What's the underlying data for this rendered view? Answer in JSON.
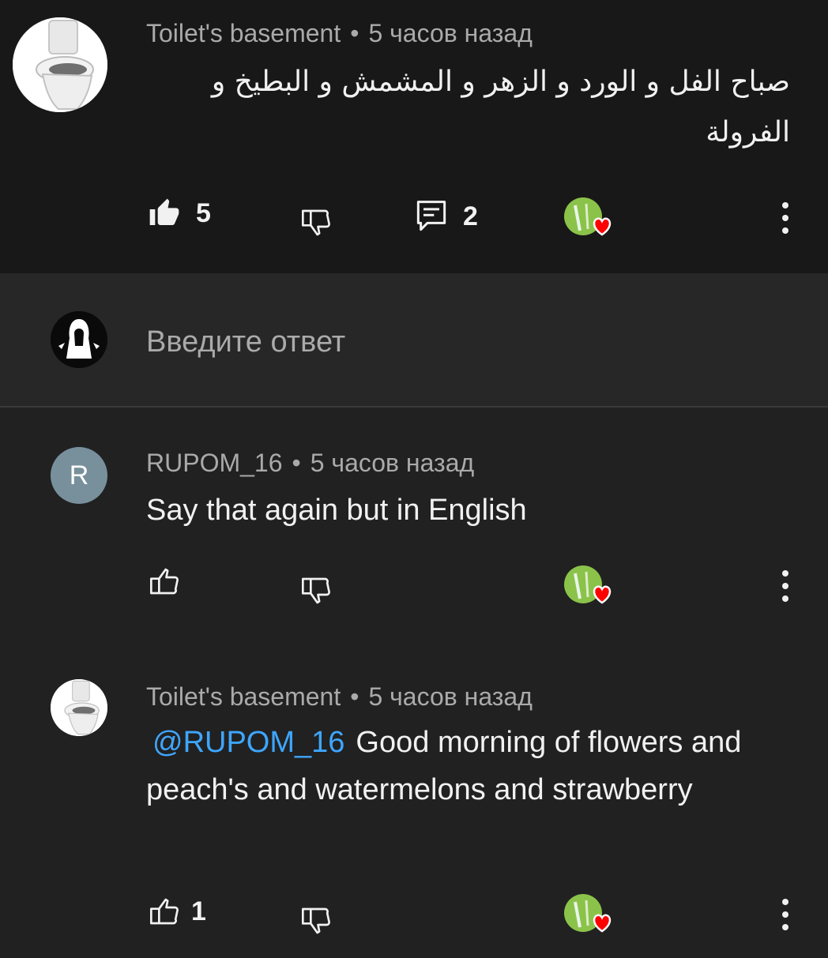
{
  "comments": [
    {
      "author": "Toilet's basement",
      "time": "5 часов назад",
      "text": "صباح الفل و الورد و الزهر و المشمش و البطيخ و الفرولة",
      "likes": "5",
      "replies": "2"
    },
    {
      "author": "RUPOM_16",
      "avatar_letter": "R",
      "time": "5 часов назад",
      "text": "Say that again but in English"
    },
    {
      "author": "Toilet's basement",
      "time": "5 часов назад",
      "mention": "@RUPOM_16",
      "text": "Good morning of flowers and peach's and watermelons and strawberry",
      "likes": "1"
    }
  ],
  "reply_input": {
    "placeholder": "Введите ответ"
  },
  "separator": "•",
  "colors": {
    "background": "#212121",
    "highlight_background": "#181818",
    "mention": "#3ea6ff",
    "heart": "#ff0000",
    "avatar_letter_bg": "#78909c"
  }
}
